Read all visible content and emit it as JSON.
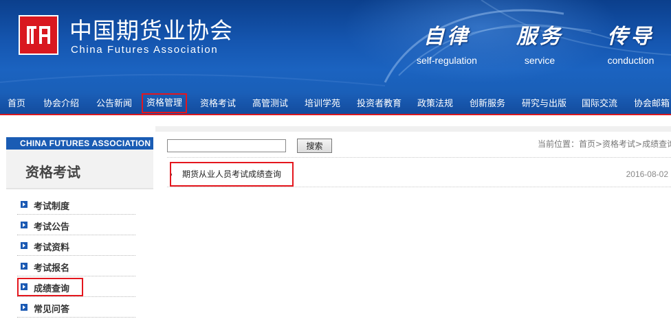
{
  "header": {
    "org_name_cn": "中国期货业协会",
    "org_name_en": "China Futures Association",
    "mottos": [
      {
        "cn": "自律",
        "en": "self-regulation"
      },
      {
        "cn": "服务",
        "en": "service"
      },
      {
        "cn": "传导",
        "en": "conduction"
      }
    ],
    "colors": {
      "banner": "#1556b0",
      "accent": "#d9181f"
    }
  },
  "nav": {
    "items": [
      {
        "label": "首页"
      },
      {
        "label": "协会介绍"
      },
      {
        "label": "公告新闻"
      },
      {
        "label": "资格管理"
      },
      {
        "label": "资格考试"
      },
      {
        "label": "高管测试"
      },
      {
        "label": "培训学苑"
      },
      {
        "label": "投资者教育"
      },
      {
        "label": "政策法规"
      },
      {
        "label": "创新服务"
      },
      {
        "label": "研究与出版"
      },
      {
        "label": "国际交流"
      },
      {
        "label": "协会邮箱"
      }
    ]
  },
  "sidebar": {
    "header": "CHINA FUTURES ASSOCIATION",
    "title": "资格考试",
    "items": [
      {
        "label": "考试制度"
      },
      {
        "label": "考试公告"
      },
      {
        "label": "考试资料"
      },
      {
        "label": "考试报名"
      },
      {
        "label": "成绩查询"
      },
      {
        "label": "常见问答"
      }
    ]
  },
  "search": {
    "value": "",
    "button_label": "搜索"
  },
  "breadcrumb": "当前位置：首页>资格考试>成绩查询",
  "articles": [
    {
      "title": "期货从业人员考试成绩查询",
      "date": "2016-08-02"
    }
  ]
}
